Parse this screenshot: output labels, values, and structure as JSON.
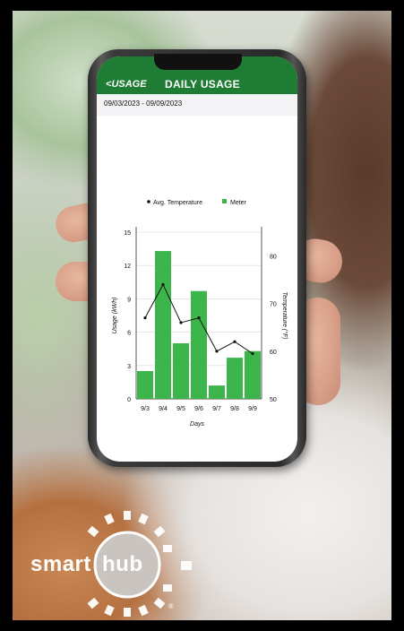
{
  "app": {
    "back_label": "USAGE",
    "title": "DAILY USAGE",
    "date_range": "09/03/2023 - 09/09/2023"
  },
  "chart_data": {
    "type": "bar",
    "categories": [
      "9/3",
      "9/4",
      "9/5",
      "9/6",
      "9/7",
      "9/8",
      "9/9"
    ],
    "series": [
      {
        "name": "Meter",
        "type": "bar",
        "axis": "left",
        "values": [
          2.5,
          13.3,
          5.0,
          9.7,
          1.2,
          3.7,
          4.3
        ]
      },
      {
        "name": "Avg. Temperature",
        "type": "line",
        "axis": "right",
        "values": [
          67,
          74,
          66,
          67,
          60,
          62,
          59.5
        ]
      }
    ],
    "xlabel": "Days",
    "ylabel": "Usage (kWh)",
    "y2label": "Temperature (°F)",
    "ylim": [
      0,
      15
    ],
    "yticks": [
      "0",
      "3",
      "6",
      "9",
      "12",
      "15"
    ],
    "y2lim": [
      50,
      85
    ],
    "y2ticks": [
      "50",
      "60",
      "70",
      "80"
    ],
    "legend_placement": "top",
    "colors": {
      "bar": "#3cb54a",
      "line": "#111111"
    }
  },
  "logo": {
    "text_left": "smart",
    "text_right": "hub",
    "mark": "®"
  }
}
